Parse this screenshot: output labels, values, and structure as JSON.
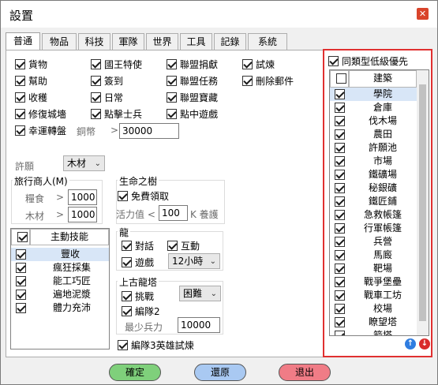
{
  "title": "設置",
  "tabs": [
    "普通",
    "物品",
    "科技",
    "軍隊",
    "世界",
    "工具",
    "記錄",
    "系統"
  ],
  "options": [
    {
      "label": "貨物",
      "on": true
    },
    {
      "label": "國王特使",
      "on": true
    },
    {
      "label": "聯盟捐獻",
      "on": true
    },
    {
      "label": "試煉",
      "on": true
    },
    {
      "label": "幫助",
      "on": true
    },
    {
      "label": "簽到",
      "on": true
    },
    {
      "label": "聯盟任務",
      "on": true
    },
    {
      "label": "刪除郵件",
      "on": true
    },
    {
      "label": "收穫",
      "on": true
    },
    {
      "label": "日常",
      "on": true
    },
    {
      "label": "聯盟寶藏",
      "on": true
    },
    {
      "label": "修復城墻",
      "on": true
    },
    {
      "label": "點擊士兵",
      "on": true
    },
    {
      "label": "點中遊戲",
      "on": true
    },
    {
      "label": "幸運轉盤",
      "on": true
    }
  ],
  "lucky": {
    "coin_label": "銅幣",
    "gt": ">",
    "value": "30000"
  },
  "permit": {
    "label": "許願",
    "value": "木材"
  },
  "merchant": {
    "title": "旅行商人(M)",
    "food_label": "糧食",
    "food_gt": ">",
    "food_value": "1000",
    "wood_label": "木材",
    "wood_gt": ">",
    "wood_value": "1000"
  },
  "life_tree": {
    "title": "生命之樹",
    "free_label": "免費領取",
    "free_on": true,
    "vital_label": "活力值 <",
    "vital_value": "100",
    "suffix": "K 養護"
  },
  "skills": {
    "header": "主動技能",
    "items": [
      "豐收",
      "瘋狂採集",
      "能工巧匠",
      "遍地泥漿",
      "體力充沛"
    ]
  },
  "dragon": {
    "title": "龍",
    "dialog_label": "對話",
    "dialog_on": true,
    "interact_label": "互動",
    "interact_on": true,
    "game_label": "遊戲",
    "game_on": true,
    "interval": "12小時"
  },
  "ancient": {
    "title": "上古龍塔",
    "challenge_label": "挑戰",
    "challenge_on": true,
    "difficulty": "困難",
    "team2_label": "編隊2",
    "team2_on": true,
    "min_troop_label": "最少兵力",
    "min_troop_value": "10000"
  },
  "team3": {
    "label": "編隊3英雄試煉",
    "on": true
  },
  "priority": {
    "label": "同類型低級優先",
    "on": true,
    "header": "建築"
  },
  "buildings": [
    "學院",
    "倉庫",
    "伐木場",
    "農田",
    "許願池",
    "市場",
    "鐵礦場",
    "秘銀礦",
    "鐵匠鋪",
    "急救帳篷",
    "行軍帳篷",
    "兵營",
    "馬廄",
    "靶場",
    "戰爭堡壘",
    "戰車工坊",
    "校場",
    "瞭望塔",
    "箭塔"
  ],
  "buttons": {
    "ok": "確定",
    "restore": "還原",
    "exit": "退出"
  },
  "colors": {
    "ok": "#7fd07b",
    "restore": "#a9c9f2",
    "exit": "#f07c86",
    "accent": "#e03030",
    "selected_row": "#d8e6f7"
  }
}
